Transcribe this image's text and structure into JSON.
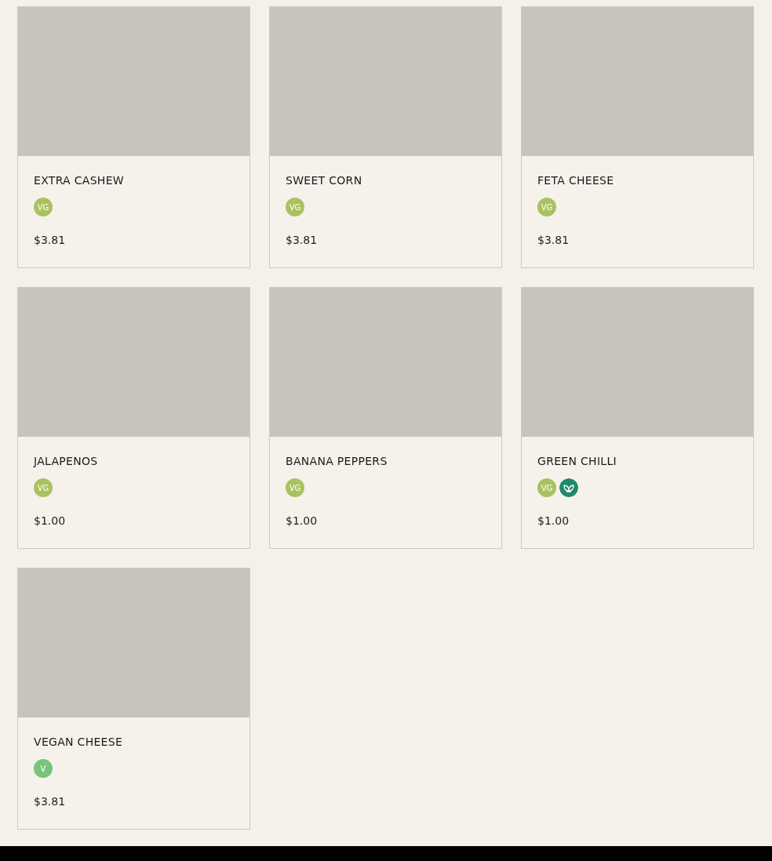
{
  "products": [
    {
      "name": "EXTRA CASHEW",
      "badges": [
        {
          "kind": "text",
          "label": "VG",
          "color": "#a9c25f"
        }
      ],
      "price": "$3.81"
    },
    {
      "name": "SWEET CORN",
      "badges": [
        {
          "kind": "text",
          "label": "VG",
          "color": "#a9c25f"
        }
      ],
      "price": "$3.81"
    },
    {
      "name": "FETA CHEESE",
      "badges": [
        {
          "kind": "text",
          "label": "VG",
          "color": "#a9c25f"
        }
      ],
      "price": "$3.81"
    },
    {
      "name": "JALAPENOS",
      "badges": [
        {
          "kind": "text",
          "label": "VG",
          "color": "#a9c25f"
        }
      ],
      "price": "$1.00"
    },
    {
      "name": "BANANA PEPPERS",
      "badges": [
        {
          "kind": "text",
          "label": "VG",
          "color": "#a9c25f"
        }
      ],
      "price": "$1.00"
    },
    {
      "name": "GREEN CHILLI",
      "badges": [
        {
          "kind": "text",
          "label": "VG",
          "color": "#a9c25f"
        },
        {
          "kind": "leaf",
          "color": "#1e8a6c"
        }
      ],
      "price": "$1.00"
    },
    {
      "name": "VEGAN CHEESE",
      "badges": [
        {
          "kind": "text",
          "label": "V",
          "color": "#78c47a"
        }
      ],
      "price": "$3.81"
    }
  ]
}
